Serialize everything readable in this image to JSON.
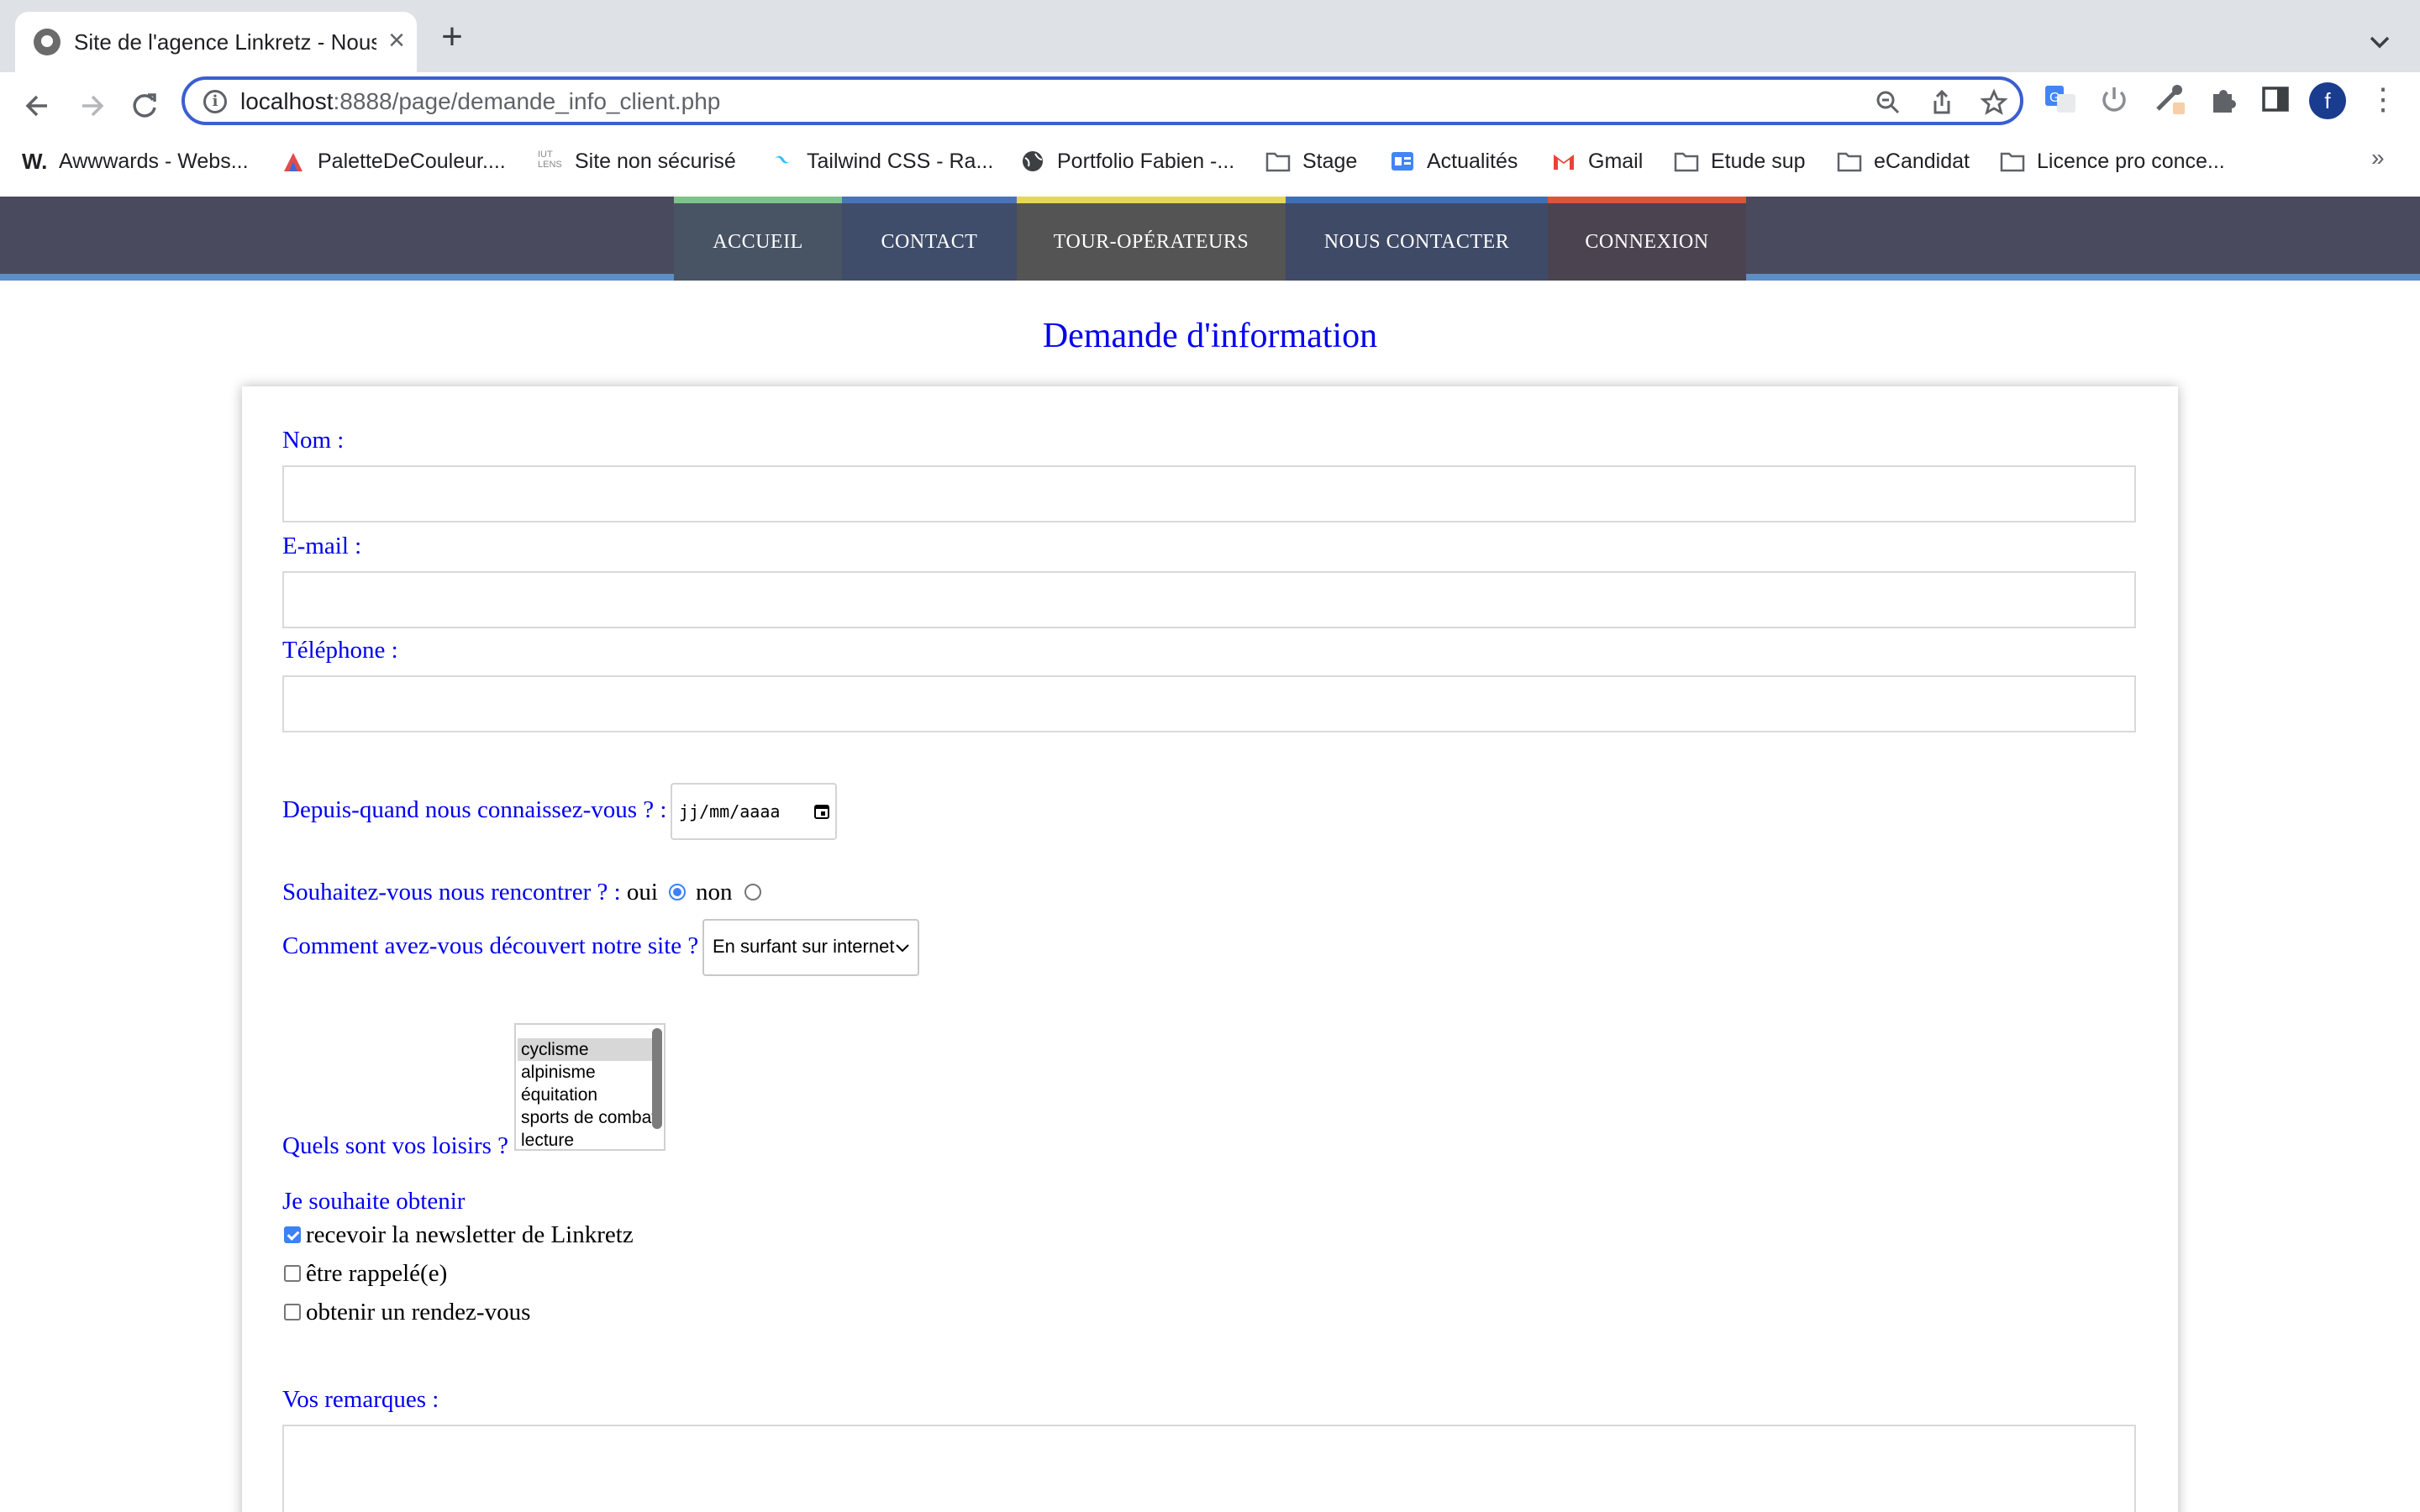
{
  "browser": {
    "tab_title": "Site de l'agence Linkretz - Nous contacter",
    "tab_close": "×",
    "new_tab": "+",
    "url_host": "localhost",
    "url_rest": ":8888/page/demande_info_client.php",
    "avatar_letter": "f",
    "menu": "⋮",
    "bookmarks": [
      {
        "label": "Awwwards - Webs...",
        "icon": "awwwards-icon"
      },
      {
        "label": "PaletteDeCouleur....",
        "icon": "palette-icon"
      },
      {
        "label": "Site non sécurisé",
        "icon": "iut-icon"
      },
      {
        "label": "Tailwind CSS - Ra...",
        "icon": "tailwind-icon"
      },
      {
        "label": "Portfolio Fabien -...",
        "icon": "globe-icon"
      },
      {
        "label": "Stage",
        "icon": "folder-icon"
      },
      {
        "label": "Actualités",
        "icon": "google-news-icon"
      },
      {
        "label": "Gmail",
        "icon": "gmail-icon"
      },
      {
        "label": "Etude sup",
        "icon": "folder-icon"
      },
      {
        "label": "eCandidat",
        "icon": "folder-icon"
      },
      {
        "label": "Licence pro conce...",
        "icon": "folder-icon"
      }
    ],
    "bookmarks_more": "»"
  },
  "site_nav": {
    "items": [
      {
        "label": "ACCUEIL",
        "bg": "#485464",
        "accent": "#7ec38a"
      },
      {
        "label": "CONTACT",
        "bg": "#3f4d6a",
        "accent": "#4a73b8"
      },
      {
        "label": "TOUR-OPÉRATEURS",
        "bg": "#545454",
        "accent": "#e6d65a"
      },
      {
        "label": "NOUS CONTACTER",
        "bg": "#3f4a66",
        "accent": "#3f6fb8"
      },
      {
        "label": "CONNEXION",
        "bg": "#4b4450",
        "accent": "#d9553c"
      }
    ]
  },
  "page": {
    "title": "Demande d'information"
  },
  "form": {
    "nom_label": "Nom :",
    "email_label": "E-mail :",
    "telephone_label": "Téléphone :",
    "since_label": "Depuis-quand nous connaissez-vous ? :",
    "date_placeholder": "jj/mm/aaaa",
    "meet_label": "Souhaitez-vous nous rencontrer ? :",
    "meet_yes": "oui",
    "meet_no": "non",
    "meet_selected": "oui",
    "discover_label": "Comment avez-vous découvert notre site ?",
    "discover_value": "En surfant sur internet",
    "hobbies_label": "Quels sont vos loisirs ?",
    "hobbies_options": [
      "cyclisme",
      "alpinisme",
      "équitation",
      "sports de combat",
      "lecture"
    ],
    "hobbies_selected": "cyclisme",
    "wish_label": "Je souhaite obtenir",
    "wishes": [
      {
        "label": "recevoir la newsletter de Linkretz",
        "checked": true
      },
      {
        "label": "être rappelé(e)",
        "checked": false
      },
      {
        "label": "obtenir un rendez-vous",
        "checked": false
      }
    ],
    "remarks_label": "Vos remarques :"
  }
}
